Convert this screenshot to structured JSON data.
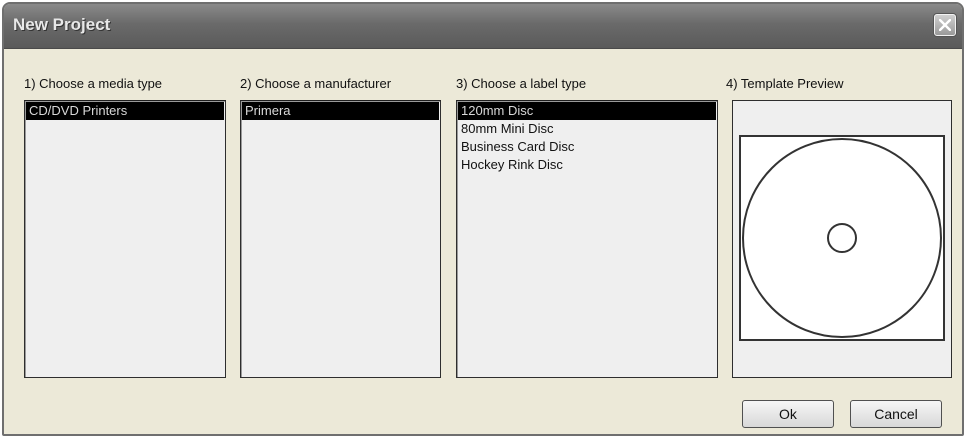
{
  "window": {
    "title": "New Project"
  },
  "columns": [
    {
      "label": "1) Choose a media type",
      "items": [
        "CD/DVD Printers"
      ],
      "selected": 0
    },
    {
      "label": "2) Choose a manufacturer",
      "items": [
        "Primera"
      ],
      "selected": 0
    },
    {
      "label": "3) Choose a label type",
      "items": [
        "120mm Disc",
        "80mm Mini Disc",
        "Business Card Disc",
        "Hockey Rink Disc"
      ],
      "selected": 0
    }
  ],
  "preview": {
    "label": "4) Template Preview"
  },
  "buttons": {
    "ok": "Ok",
    "cancel": "Cancel"
  },
  "icons": {
    "close": "close-icon",
    "disc": "disc-template-icon"
  },
  "colors": {
    "title_bar": "#6a6a6a",
    "selection": "#000000",
    "dialog_bg": "#ece9d8"
  }
}
